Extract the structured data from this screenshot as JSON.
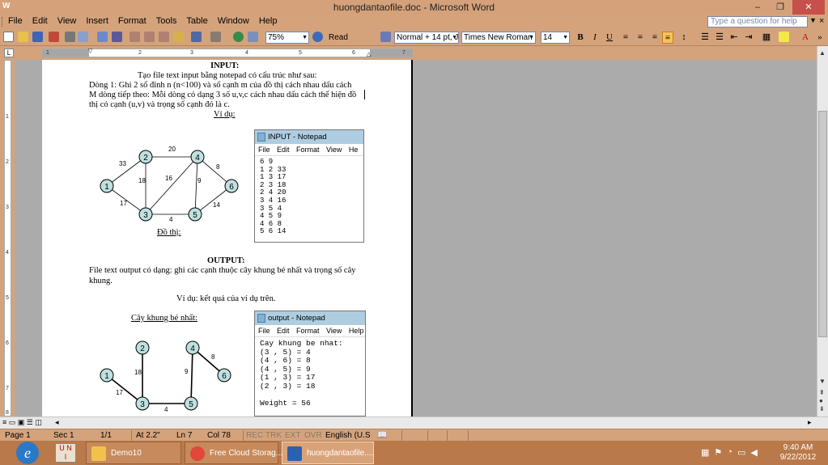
{
  "window": {
    "title": "huongdantaofile.doc - Microsoft Word",
    "min": "–",
    "restore": "❐",
    "close": "✕"
  },
  "menubar": {
    "items": [
      "File",
      "Edit",
      "View",
      "Insert",
      "Format",
      "Tools",
      "Table",
      "Window",
      "Help"
    ],
    "help_placeholder": "Type a question for help",
    "doc_close": "×"
  },
  "toolbar": {
    "zoom": "75%",
    "read": "Read",
    "style": "Normal + 14 pt, J",
    "font": "Times New Roman",
    "size": "14",
    "bold": "B",
    "italic": "I",
    "underline": "U"
  },
  "ruler": {
    "labels": [
      "1",
      "2",
      "3",
      "4",
      "5",
      "6",
      "7"
    ]
  },
  "vruler": {
    "labels": [
      "1",
      "2",
      "3",
      "4",
      "5",
      "6",
      "7",
      "8"
    ]
  },
  "document": {
    "input_heading": "INPUT:",
    "line1": "Tạo file text input bằng notepad có cấu trúc như sau:",
    "line2": "Dòng 1: Ghi 2 số đỉnh n (n<100) và số cạnh m của đồ thị cách nhau dấu cách",
    "line3": "M dòng tiếp theo: Mỗi dòng có dạng 3  số u,v,c cách nhau dấu cách thể hiện đồ",
    "line4": "thị có cạnh (u,v) và trọng số cạnh đó là c.",
    "example1": "Ví dụ:",
    "graph_caption": "Đồ thị:",
    "output_heading": "OUTPUT:",
    "output_line1": "File text output có dạng: ghi các cạnh thuộc cây khung bé nhất và trọng số cây",
    "output_line2": "khung.",
    "example2": "Ví dụ: kết quả của ví dụ trên.",
    "tree_caption": "Cây khung bé nhất:"
  },
  "graph": {
    "nodes": [
      "1",
      "2",
      "3",
      "4",
      "5",
      "6"
    ],
    "weights": [
      "33",
      "20",
      "18",
      "16",
      "9",
      "8",
      "17",
      "4",
      "14"
    ]
  },
  "tree": {
    "nodes": [
      "1",
      "2",
      "3",
      "4",
      "5",
      "6"
    ],
    "weights": [
      "18",
      "9",
      "8",
      "17",
      "4"
    ]
  },
  "notepad_input": {
    "title": "INPUT - Notepad",
    "menu": "File Edit Format View He",
    "lines": [
      "6 9",
      "1 2 33",
      "1 3 17",
      "2 3 18",
      "2 4 20",
      "3 4 16",
      "3 5 4",
      "4 5 9",
      "4 6 8",
      "5 6 14"
    ]
  },
  "notepad_output": {
    "title": "output - Notepad",
    "menu": "File Edit Format View Help",
    "lines": [
      "Cay khung be nhat:",
      "(3 , 5) = 4",
      "(4 , 6) = 8",
      "(4 , 5) = 9",
      "(1 , 3) = 17",
      "(2 , 3) = 18",
      "",
      "Weight = 56"
    ]
  },
  "status": {
    "page": "Page 1",
    "sec": "Sec 1",
    "of": "1/1",
    "at": "At 2.2\"",
    "ln": "Ln 7",
    "col": "Col 78",
    "rec": "REC",
    "trk": "TRK",
    "ext": "EXT",
    "ovr": "OVR",
    "lang": "English (U.S"
  },
  "taskbar": {
    "apps": [
      {
        "label": "Demo10"
      },
      {
        "label": "Free Cloud Storag..."
      },
      {
        "label": "huongdantaofile...."
      }
    ],
    "time": "9:40 AM",
    "date": "9/22/2012"
  },
  "colors": {
    "chrome": "#d4a37c",
    "taskbar": "#b9794a",
    "node_fill": "#bfe0e0"
  }
}
